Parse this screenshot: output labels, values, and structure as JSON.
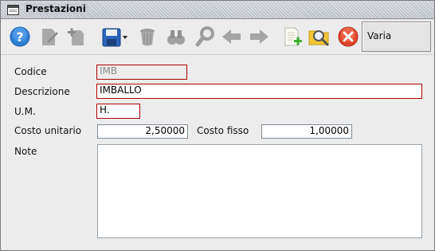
{
  "window": {
    "title": "Prestazioni"
  },
  "toolbar": {
    "buttons": [
      {
        "name": "help-icon",
        "enabled": true
      },
      {
        "name": "edit-icon",
        "enabled": false
      },
      {
        "name": "new-icon",
        "enabled": false
      },
      {
        "name": "save-icon",
        "enabled": true
      },
      {
        "name": "delete-icon",
        "enabled": false
      },
      {
        "name": "find-icon",
        "enabled": false
      },
      {
        "name": "search-icon",
        "enabled": false
      },
      {
        "name": "arrow-left-icon",
        "enabled": false
      },
      {
        "name": "arrow-right-icon",
        "enabled": false
      },
      {
        "name": "new-document-icon",
        "enabled": true
      },
      {
        "name": "search-folder-icon",
        "enabled": true
      },
      {
        "name": "close-icon",
        "enabled": true
      }
    ],
    "mode_label": "Varia"
  },
  "form": {
    "codice_label": "Codice",
    "codice_value": "IMB",
    "descrizione_label": "Descrizione",
    "descrizione_value": "IMBALLO",
    "um_label": "U.M.",
    "um_value": "H.",
    "costo_unitario_label": "Costo unitario",
    "costo_unitario_value": "2,50000",
    "costo_fisso_label": "Costo fisso",
    "costo_fisso_value": "1,00000",
    "note_label": "Note",
    "note_value": ""
  }
}
